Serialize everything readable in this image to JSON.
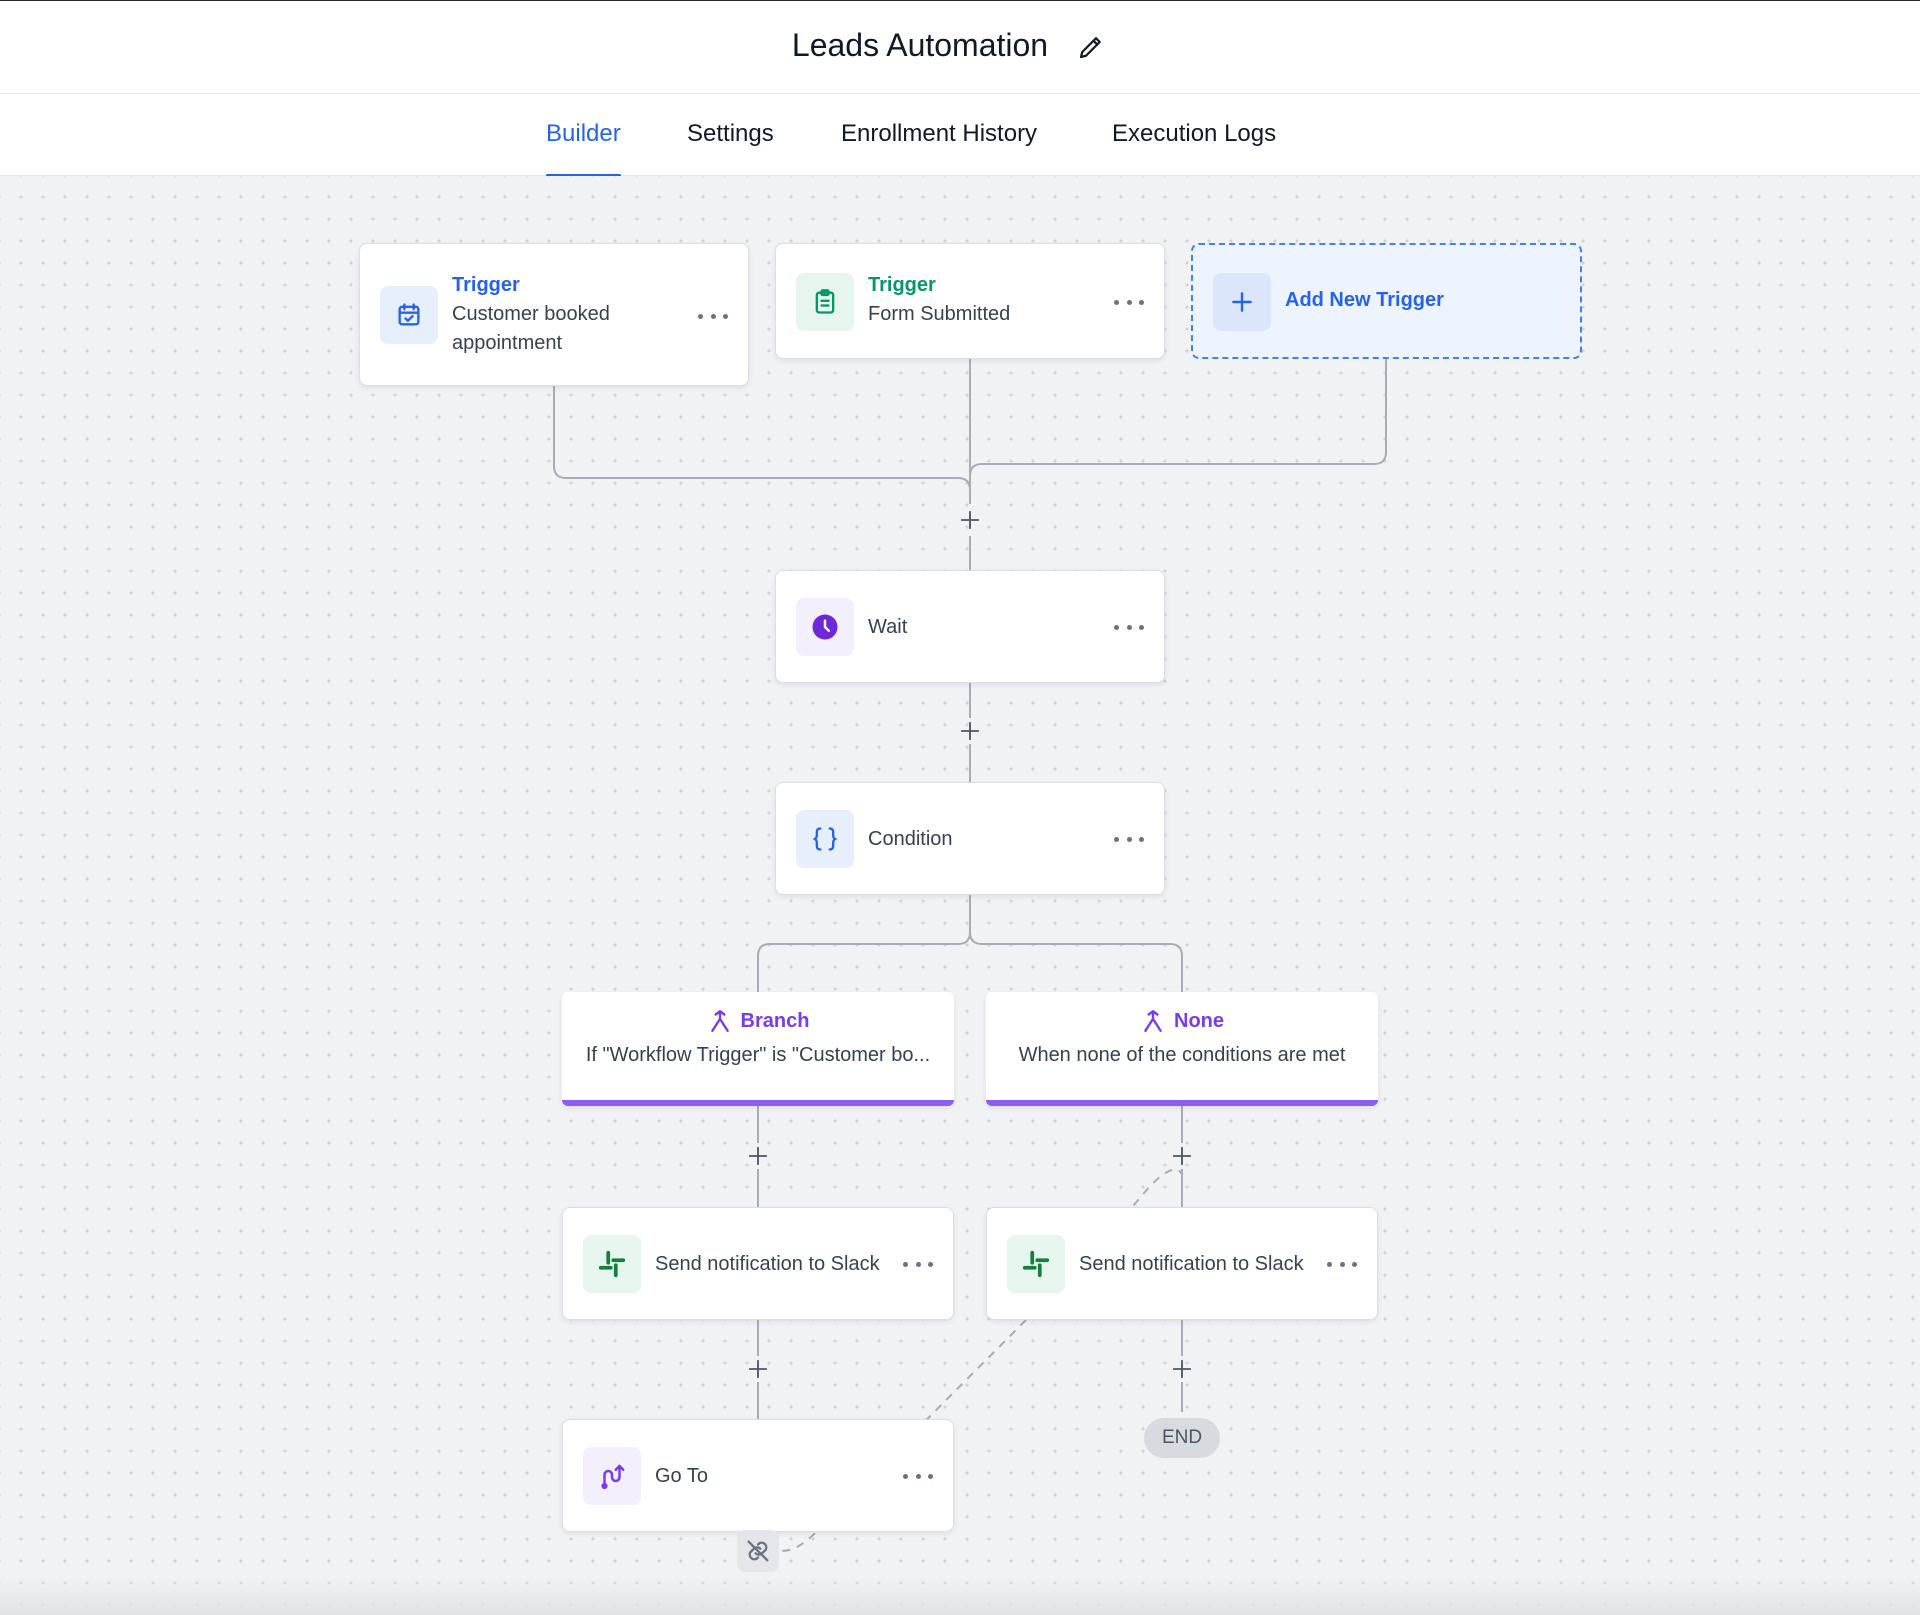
{
  "header": {
    "title": "Leads Automation",
    "edit_icon": "pencil-icon"
  },
  "tabs": [
    {
      "label": "Builder",
      "active": true
    },
    {
      "label": "Settings",
      "active": false
    },
    {
      "label": "Enrollment History",
      "active": false
    },
    {
      "label": "Execution Logs",
      "active": false
    }
  ],
  "triggers": [
    {
      "kind": "Trigger",
      "label_line1": "Customer booked",
      "label_line2": "appointment",
      "icon": "calendar-check-icon",
      "color": "#2563eb"
    },
    {
      "kind": "Trigger",
      "label": "Form Submitted",
      "icon": "clipboard-icon",
      "color": "#059669"
    }
  ],
  "add_trigger": {
    "label": "Add New Trigger"
  },
  "steps": {
    "wait": {
      "label": "Wait",
      "icon": "clock-icon"
    },
    "condition": {
      "label": "Condition",
      "icon": "braces-icon"
    },
    "branch": {
      "title": "Branch",
      "text": "If \"Workflow Trigger\" is \"Customer bo...",
      "icon": "branch-icon"
    },
    "none": {
      "title": "None",
      "text": "When none of the conditions are met",
      "icon": "branch-icon"
    },
    "slack_left": {
      "label": "Send notification to Slack",
      "icon": "slack-icon"
    },
    "slack_right": {
      "label": "Send notification to Slack",
      "icon": "slack-icon"
    },
    "goto": {
      "label": "Go To",
      "icon": "goto-icon"
    },
    "end": {
      "label": "END"
    }
  },
  "colors": {
    "accent": "#2563eb",
    "trigger_green": "#059669",
    "purple": "#7c3aed",
    "branch_bar": "#8b5cf6",
    "slack_green": "#15803d"
  }
}
